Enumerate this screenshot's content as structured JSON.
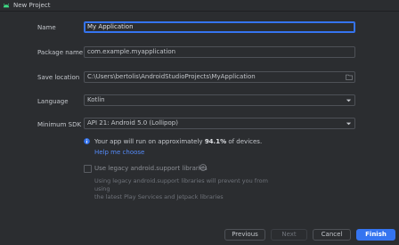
{
  "window": {
    "title": "New Project"
  },
  "form": {
    "name_label": "Name",
    "name_value": "My Application",
    "package_label": "Package name",
    "package_value": "com.example.myapplication",
    "save_label": "Save location",
    "save_value": "C:\\Users\\bertolis\\AndroidStudioProjects\\MyApplication",
    "language_label": "Language",
    "language_value": "Kotlin",
    "sdk_label": "Minimum SDK",
    "sdk_value": "API 21: Android 5.0 (Lollipop)"
  },
  "info": {
    "text_prefix": "Your app will run on approximately ",
    "percent": "94.1%",
    "text_suffix": " of devices.",
    "help_link": "Help me choose"
  },
  "legacy": {
    "checkbox_label": "Use legacy android.support libraries",
    "checked": false,
    "description_line1": "Using legacy android.support libraries will prevent you from using",
    "description_line2": "the latest Play Services and Jetpack libraries"
  },
  "buttons": {
    "previous": "Previous",
    "next": "Next",
    "cancel": "Cancel",
    "finish": "Finish"
  },
  "colors": {
    "accent": "#3574f0",
    "link": "#548af7",
    "android_green": "#3ddc84"
  },
  "icons": {
    "app": "android-icon",
    "folder": "folder-icon",
    "dropdown": "chevron-down-icon",
    "info": "info-icon",
    "help": "question-icon"
  }
}
